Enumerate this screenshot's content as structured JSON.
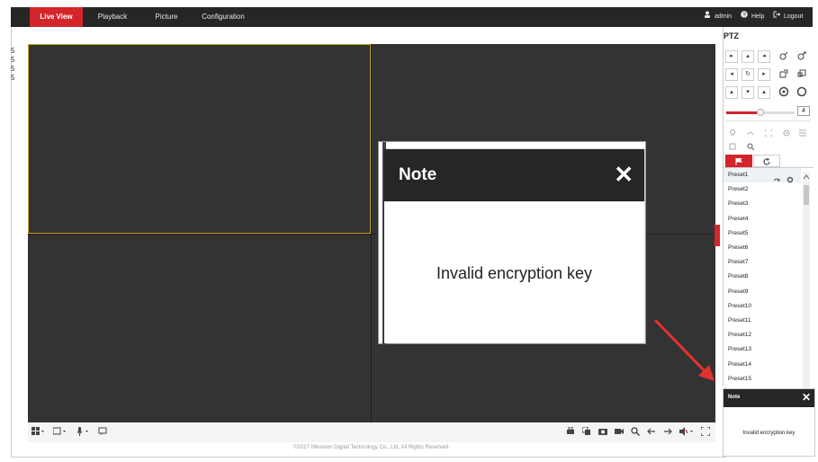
{
  "nav": {
    "tabs": [
      {
        "label": "Live View",
        "active": true
      },
      {
        "label": "Playback",
        "active": false
      },
      {
        "label": "Picture",
        "active": false
      },
      {
        "label": "Configuration",
        "active": false
      }
    ],
    "user_label": "admin",
    "help_label": "Help",
    "logout_label": "Logout"
  },
  "left_marks": [
    "5",
    "5",
    "5",
    "5"
  ],
  "dialog": {
    "title": "Note",
    "close_glyph": "✕",
    "message": "Invalid encryption key"
  },
  "ptz": {
    "title": "PTZ",
    "speed_value": "4",
    "speed_level_fraction": 0.5,
    "direction_buttons": [
      "▸",
      "▴",
      "◂",
      "◂",
      "↻",
      "▸",
      "▴",
      "▾",
      "▴"
    ],
    "preset_tab_icons": [
      "flag-icon",
      "refresh-icon"
    ],
    "presets": [
      "Preset1",
      "Preset2",
      "Preset3",
      "Preset4",
      "Preset5",
      "Preset6",
      "Preset7",
      "Preset8",
      "Preset9",
      "Preset10",
      "Preset11",
      "Preset12",
      "Preset13",
      "Preset14",
      "Preset15"
    ]
  },
  "mini_note": {
    "title": "Note",
    "close_glyph": "✕",
    "message": "Invalid encryption key"
  },
  "footer": {
    "copyright": "©2017 Hikvision Digital Technology Co., Ltd. All Rights Reserved."
  },
  "colors": {
    "accent_red": "#d3262a",
    "topbar": "#262626",
    "video_bg": "#333333",
    "selected_border": "#c8a320"
  }
}
